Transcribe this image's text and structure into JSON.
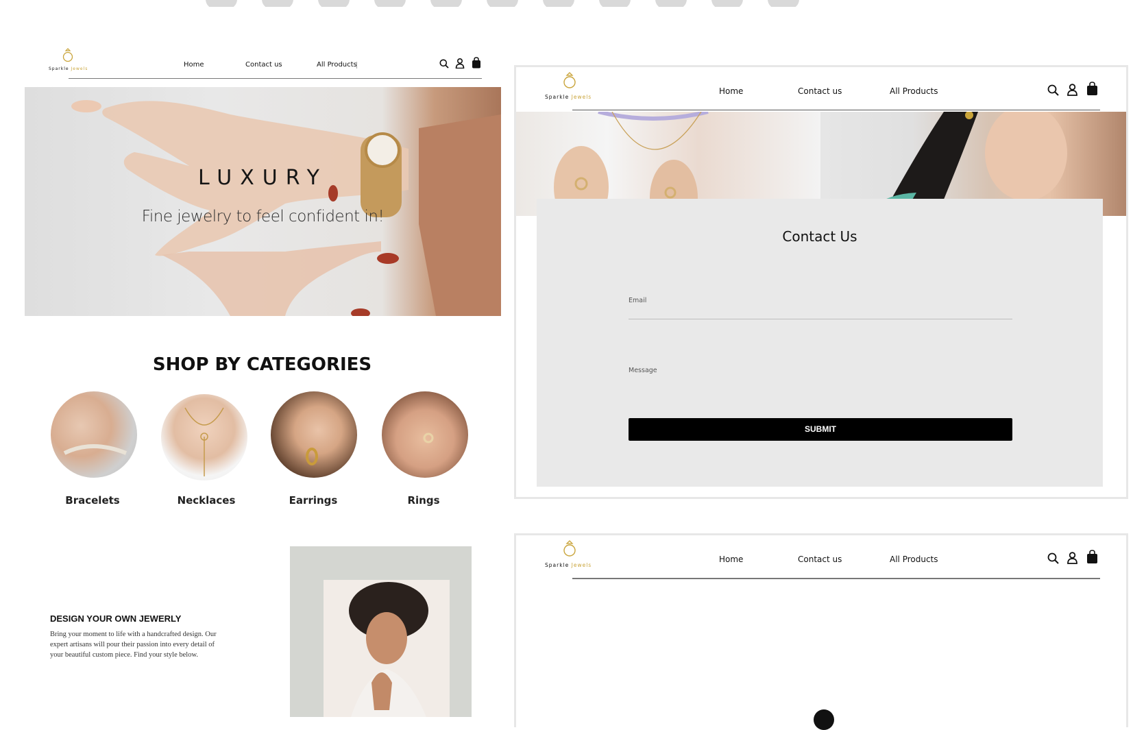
{
  "brand": {
    "logo_part1": "Sparkle",
    "logo_part2": "Jewels"
  },
  "nav": {
    "home": "Home",
    "contact": "Contact us",
    "products": "All Products"
  },
  "hero": {
    "title": "LUXURY",
    "subtitle": "Fine jewelry to feel confident in!"
  },
  "categories": {
    "heading": "SHOP BY CATEGORIES",
    "items": [
      {
        "label": "Bracelets"
      },
      {
        "label": "Necklaces"
      },
      {
        "label": "Earrings"
      },
      {
        "label": "Rings"
      }
    ]
  },
  "design": {
    "title": "DESIGN YOUR OWN JEWERLY",
    "body": "Bring your moment to life with a handcrafted design. Our expert artisans will pour their passion into every detail of your beautiful custom piece. Find your style below."
  },
  "contact": {
    "heading": "Contact Us",
    "email_label": "Email",
    "message_label": "Message",
    "submit_label": "SUBMIT"
  },
  "icons": [
    "search-icon",
    "user-icon",
    "shopping-bag-icon",
    "ring-logo-icon"
  ],
  "colors": {
    "brand_gold": "#c9a43a",
    "panel_gray": "#e9e9e9",
    "button_black": "#000000"
  }
}
